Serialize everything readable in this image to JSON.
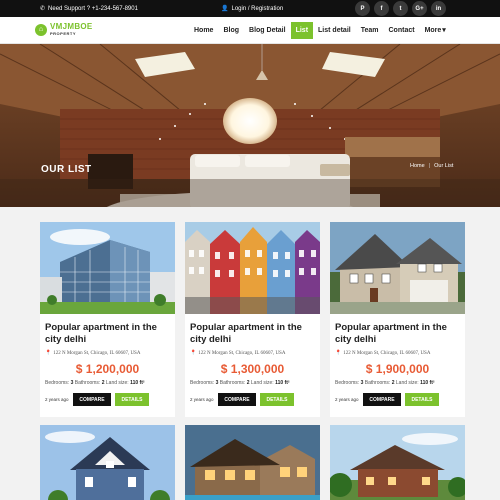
{
  "topbar": {
    "support": "Need Support ? +1-234-567-8901",
    "login": "Login / Registration",
    "social": [
      "P",
      "f",
      "t",
      "G+",
      "in"
    ]
  },
  "brand": {
    "name": "VMJMBOE",
    "sub": "PROPERTY",
    "color": "#7cc22d"
  },
  "menu": {
    "items": [
      "Home",
      "Blog",
      "Blog Detail",
      "List",
      "List detail",
      "Team",
      "Contact",
      "More"
    ],
    "active": "List"
  },
  "hero": {
    "title": "OUR LIST",
    "breadcrumb": [
      "Home",
      "Our List"
    ]
  },
  "listings": [
    {
      "title": "Popular apartment in the city delhi",
      "address": "122 N Morgan St, Chicago, IL 60607, USA",
      "price": "$ 1,200,000",
      "bedrooms": "3",
      "bathrooms": "2",
      "land_size": "110 ft²",
      "posted": "2 years ago",
      "compare": "COMPARE",
      "details": "DETAILS"
    },
    {
      "title": "Popular apartment in the city delhi",
      "address": "122 N Morgan St, Chicago, IL 60607, USA",
      "price": "$ 1,300,000",
      "bedrooms": "3",
      "bathrooms": "2",
      "land_size": "110 ft²",
      "posted": "2 years ago",
      "compare": "COMPARE",
      "details": "DETAILS"
    },
    {
      "title": "Popular apartment in the city delhi",
      "address": "122 N Morgan St, Chicago, IL 60607, USA",
      "price": "$ 1,900,000",
      "bedrooms": "3",
      "bathrooms": "2",
      "land_size": "110 ft²",
      "posted": "2 years ago",
      "compare": "COMPARE",
      "details": "DETAILS"
    }
  ],
  "labels": {
    "bedrooms": "Bedrooms:",
    "bathrooms": "Bathrooms:",
    "land_size": "Land size:"
  },
  "colors": {
    "accent": "#7cc22d",
    "price": "#e85b35",
    "dark": "#111111"
  }
}
